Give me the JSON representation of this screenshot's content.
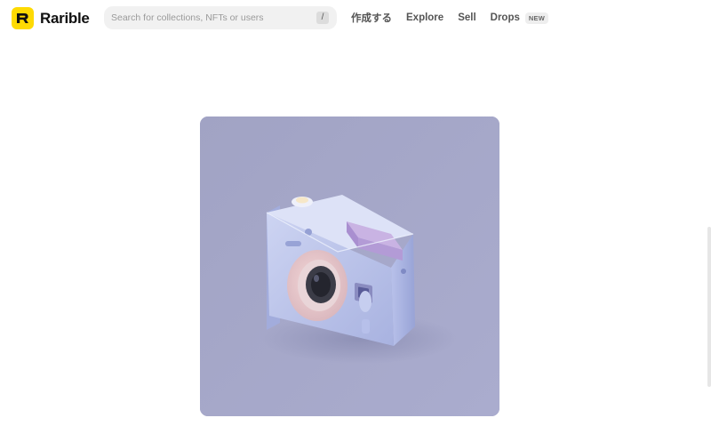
{
  "brand": {
    "name": "Rarible",
    "logo_color": "#FEDA03"
  },
  "search": {
    "placeholder": "Search for collections, NFTs or users",
    "shortcut_key": "/"
  },
  "nav": {
    "items": [
      {
        "label": "作成する"
      },
      {
        "label": "Explore"
      },
      {
        "label": "Sell"
      },
      {
        "label": "Drops",
        "badge": "NEW"
      }
    ]
  },
  "artwork": {
    "subject": "camera-illustration",
    "background_color": "#A4A6C8",
    "camera_color": "#C3CBEB",
    "accent_color": "#B9A8D8"
  }
}
